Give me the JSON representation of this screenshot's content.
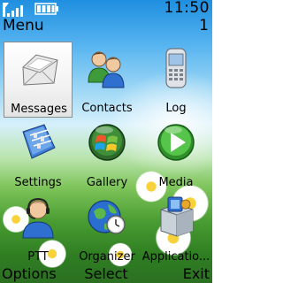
{
  "status": {
    "time": "11:50",
    "signal_icon": "signal-strength-icon",
    "battery_icon": "battery-icon"
  },
  "header": {
    "title": "Menu",
    "count": "1"
  },
  "menu": {
    "items": [
      {
        "label": "Messages",
        "icon": "envelope-icon",
        "selected": true
      },
      {
        "label": "Contacts",
        "icon": "contacts-icon",
        "selected": false
      },
      {
        "label": "Log",
        "icon": "phone-log-icon",
        "selected": false
      },
      {
        "label": "Settings",
        "icon": "settings-icon",
        "selected": false
      },
      {
        "label": "Gallery",
        "icon": "windows-logo-icon",
        "selected": false
      },
      {
        "label": "Media",
        "icon": "play-icon",
        "selected": false
      },
      {
        "label": "PTT",
        "icon": "headset-person-icon",
        "selected": false
      },
      {
        "label": "Organizer",
        "icon": "globe-clock-icon",
        "selected": false
      },
      {
        "label": "Applicatio...",
        "icon": "applications-box-icon",
        "selected": false
      }
    ]
  },
  "softkeys": {
    "left": "Options",
    "middle": "Select",
    "right": "Exit"
  }
}
